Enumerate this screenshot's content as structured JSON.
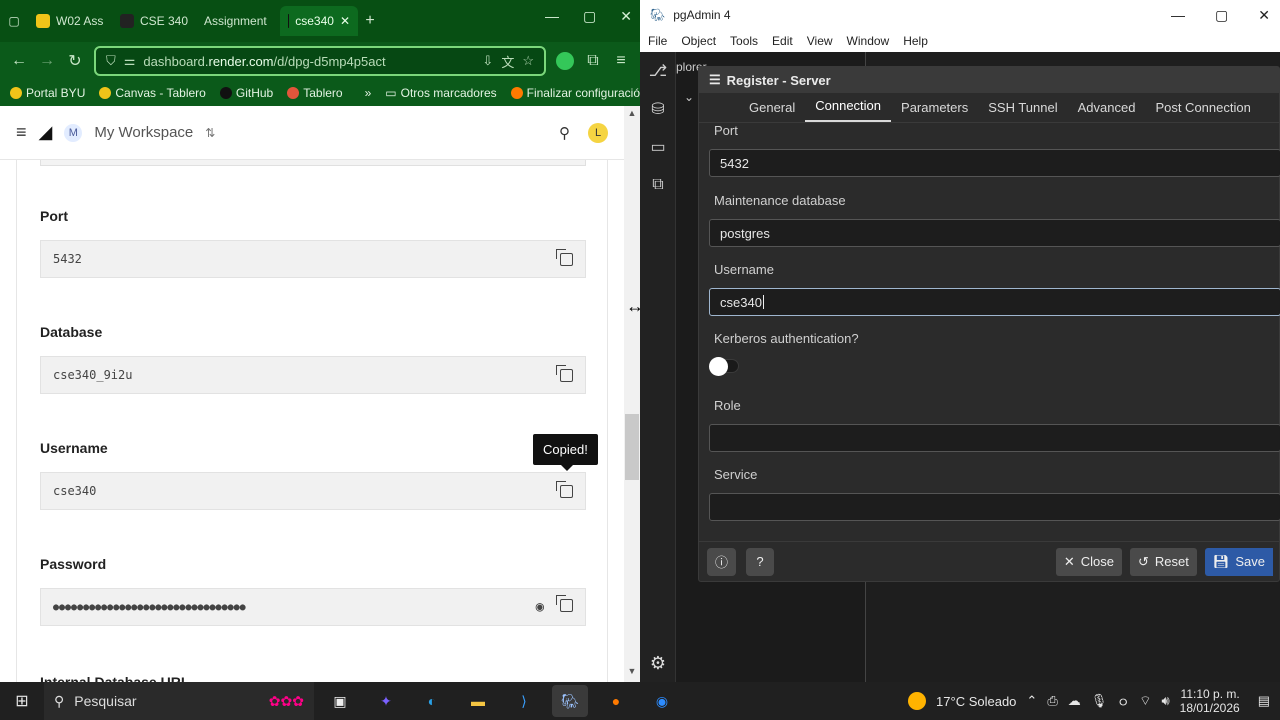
{
  "browser": {
    "tabs": [
      {
        "label": "W02 Ass",
        "color": "#f0c419"
      },
      {
        "label": "CSE 340",
        "color": "#222222"
      },
      {
        "label": "Assignment",
        "color": "#0b5a1a"
      },
      {
        "label": "cse340",
        "color": "#111111",
        "active": true
      }
    ],
    "address": {
      "prefix": "dashboard.",
      "host": "render.com",
      "path": "/d/dpg-d5mp4p5act"
    },
    "bookmarks": [
      "Portal BYU",
      "Canvas - Tablero",
      "GitHub",
      "Tablero",
      "»",
      "Otros marcadores",
      "Finalizar configuración"
    ],
    "header": {
      "workspace_avatar": "M",
      "workspace_name": "My Workspace",
      "user_avatar": "L"
    },
    "fields": [
      {
        "label": "Port",
        "value": "5432"
      },
      {
        "label": "Database",
        "value": "cse340_9i2u"
      },
      {
        "label": "Username",
        "value": "cse340"
      },
      {
        "label": "Password",
        "value": "●●●●●●●●●●●●●●●●●●●●●●●●●●●●●●●●"
      }
    ],
    "tooltip": "Copied!",
    "partial_label": "Internal Database URL"
  },
  "pgadmin": {
    "title": "pgAdmin 4",
    "menu": [
      "File",
      "Object",
      "Tools",
      "Edit",
      "View",
      "Window",
      "Help"
    ],
    "explorer_label": "plorer",
    "dialog": {
      "title": "Register - Server",
      "tabs": [
        "General",
        "Connection",
        "Parameters",
        "SSH Tunnel",
        "Advanced",
        "Post Connection"
      ],
      "active_tab": "Connection",
      "fields": [
        {
          "label": "Port",
          "value": "5432"
        },
        {
          "label": "Maintenance database",
          "value": "postgres"
        },
        {
          "label": "Username",
          "value": "cse340"
        },
        {
          "label": "Role",
          "value": ""
        },
        {
          "label": "Service",
          "value": ""
        }
      ],
      "kerberos_label": "Kerberos authentication?",
      "buttons": {
        "close": "Close",
        "reset": "Reset",
        "save": "Save"
      }
    }
  },
  "taskbar": {
    "search_placeholder": "Pesquisar",
    "weather": "17°C Soleado",
    "time": "11:10 p. m.",
    "date": "18/01/2026"
  }
}
